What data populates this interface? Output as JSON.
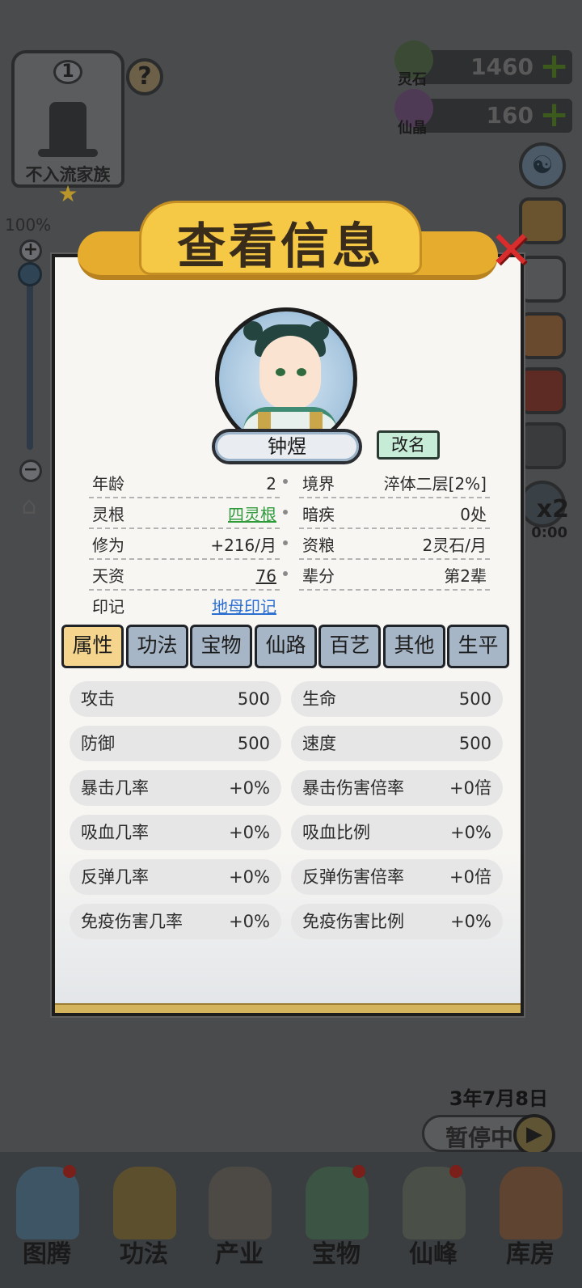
{
  "hud": {
    "family_rank": "1",
    "family_name": "不入流家族",
    "help_icon": "question-mark-icon",
    "zoom": {
      "percent_label": "100%",
      "level": 1.0
    },
    "currencies": [
      {
        "label": "灵石",
        "value": "1460",
        "icon": "spirit-stone-icon",
        "plus": "+"
      },
      {
        "label": "仙晶",
        "value": "160",
        "icon": "immortal-crystal-icon",
        "plus": "+"
      }
    ],
    "speed": {
      "multiplier": "x2",
      "time": "0:00"
    },
    "date": "3年7月8日",
    "pause_label": "暂停中"
  },
  "bottom_nav": [
    {
      "label": "图腾",
      "icon": "totem-icon",
      "dot": true
    },
    {
      "label": "功法",
      "icon": "technique-icon",
      "dot": false
    },
    {
      "label": "产业",
      "icon": "industry-icon",
      "dot": false
    },
    {
      "label": "宝物",
      "icon": "treasure-icon",
      "dot": true
    },
    {
      "label": "仙峰",
      "icon": "peak-icon",
      "dot": true
    },
    {
      "label": "库房",
      "icon": "storehouse-icon",
      "dot": false
    }
  ],
  "dialog": {
    "title": "查看信息",
    "character": {
      "name": "钟煜",
      "rename_label": "改名"
    },
    "info": [
      {
        "left": {
          "k": "年龄",
          "v": "2"
        },
        "right": {
          "k": "境界",
          "v": "淬体二层[2%]"
        }
      },
      {
        "left": {
          "k": "灵根",
          "v": "四灵根"
        },
        "right": {
          "k": "暗疾",
          "v": "0处"
        }
      },
      {
        "left": {
          "k": "修为",
          "v": "+216/月"
        },
        "right": {
          "k": "资粮",
          "v": "2灵石/月"
        }
      },
      {
        "left": {
          "k": "天资",
          "v": "76"
        },
        "right": {
          "k": "辈分",
          "v": "第2辈"
        }
      },
      {
        "left": {
          "k": "印记",
          "v": "地母印记"
        }
      }
    ],
    "tabs": [
      "属性",
      "功法",
      "宝物",
      "仙路",
      "百艺",
      "其他",
      "生平"
    ],
    "active_tab": 0,
    "stats": [
      [
        {
          "k": "攻击",
          "v": "500"
        },
        {
          "k": "生命",
          "v": "500"
        }
      ],
      [
        {
          "k": "防御",
          "v": "500"
        },
        {
          "k": "速度",
          "v": "500"
        }
      ],
      [
        {
          "k": "暴击几率",
          "v": "+0%"
        },
        {
          "k": "暴击伤害倍率",
          "v": "+0倍"
        }
      ],
      [
        {
          "k": "吸血几率",
          "v": "+0%"
        },
        {
          "k": "吸血比例",
          "v": "+0%"
        }
      ],
      [
        {
          "k": "反弹几率",
          "v": "+0%"
        },
        {
          "k": "反弹伤害倍率",
          "v": "+0倍"
        }
      ],
      [
        {
          "k": "免疫伤害几率",
          "v": "+0%"
        },
        {
          "k": "免疫伤害比例",
          "v": "+0%"
        }
      ]
    ]
  },
  "colors": {
    "tab_active": "#f5d58d",
    "tab_inactive": "#a6b6c6",
    "spirit_root": "#2e9a3a",
    "mark_link": "#2b6fd1",
    "close": "#d92c2c"
  }
}
